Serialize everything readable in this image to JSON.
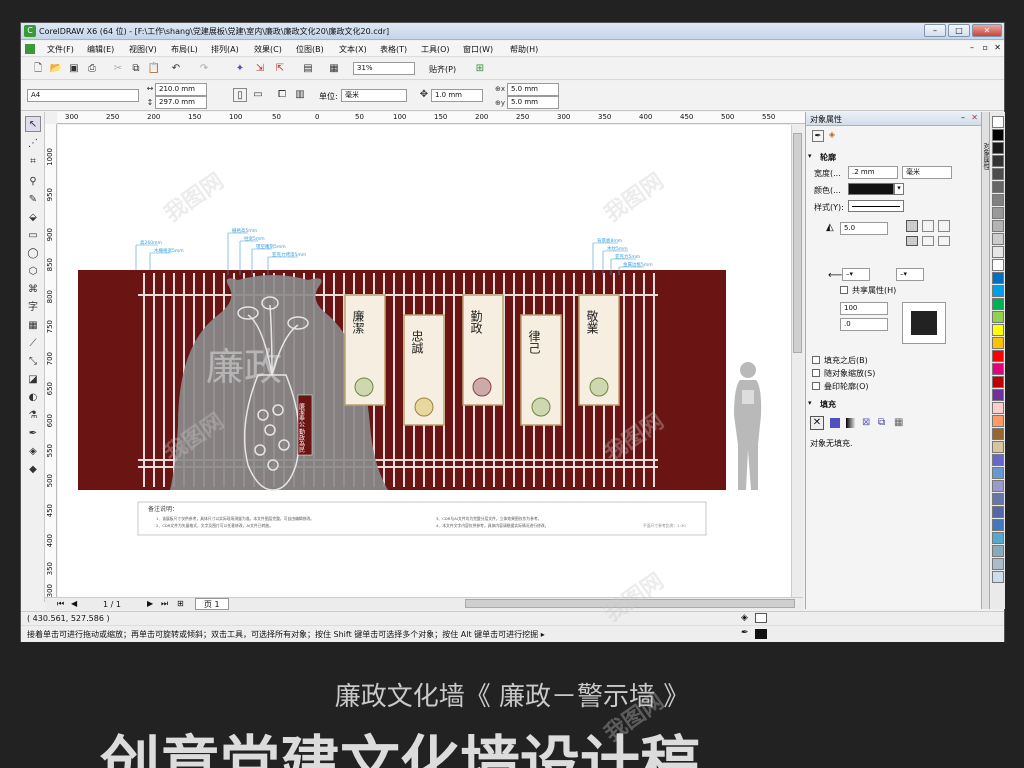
{
  "window_title": "CorelDRAW X6 (64 位) - [F:\\工作\\shang\\党建展板\\党建\\室内\\廉政\\廉政文化20\\廉政文化20.cdr]",
  "menu": [
    "文件(F)",
    "编辑(E)",
    "视图(V)",
    "布局(L)",
    "排列(A)",
    "效果(C)",
    "位图(B)",
    "文本(X)",
    "表格(T)",
    "工具(O)",
    "窗口(W)",
    "帮助(H)"
  ],
  "standard_bar": {
    "zoom": "31%",
    "snap": "贴齐(P)"
  },
  "property_bar": {
    "page_size": "A4",
    "width": "210.0 mm",
    "height": "297.0 mm",
    "units_label": "单位:",
    "units": "毫米",
    "nudge": "1.0 mm",
    "dup_x": "5.0 mm",
    "dup_y": "5.0 mm"
  },
  "hruler": [
    "300",
    "250",
    "200",
    "150",
    "100",
    "50",
    "0",
    "50",
    "100",
    "150",
    "200",
    "250",
    "300",
    "350",
    "400",
    "450",
    "500",
    "550"
  ],
  "vruler": [
    "1000",
    "950",
    "900",
    "850",
    "800",
    "750",
    "700",
    "650",
    "600",
    "550",
    "500",
    "450",
    "400",
    "350",
    "300"
  ],
  "design": {
    "wall_color": "#6b1414",
    "ghost_text": "廉政",
    "panels": [
      {
        "title": "廉潔"
      },
      {
        "title": "忠誠"
      },
      {
        "title": "勤政"
      },
      {
        "title": "律己"
      },
      {
        "title": "敬業"
      }
    ],
    "seal_text": "廉潔奉公 勤政為民",
    "notes_title": "备注说明：",
    "notes_left": [
      "1、该展板尺寸仅供参考，具体尺寸以实际现场测量为准。本文件图层完整，可自由编辑修改。",
      "2、CDR文件为矢量格式，文字及图片可以任意修改，AI文件已转曲。"
    ],
    "notes_right": [
      "3、CDR与AI文件均为完整分层文件，立体效果图仅作为参考。",
      "4、本文件文字内容仅供参考，具体内容请根据实际情况进行修改。"
    ],
    "notes_scale": "平面尺寸参考比例：1:30",
    "dim_left": [
      "高260mm",
      "木栅格宽5mm"
    ],
    "dim_mid": [
      "栅格高5mm",
      "柱宽5mm",
      "镂空雕刻5mm",
      "亚克力烤漆5mm"
    ],
    "dim_right": [
      "背景板8mm",
      "木纹5mm",
      "亚克力5mm",
      "金属边框5mm"
    ]
  },
  "page_nav": {
    "counter": "1 / 1",
    "tab": "页 1"
  },
  "status": {
    "coords": "( 430.561, 527.586 )",
    "hint": "接着单击可进行拖动或缩放；再单击可旋转或倾斜；双击工具，可选择所有对象；按住 Shift 键单击可选择多个对象；按住 Alt 键单击可进行挖掘 ▸"
  },
  "docker": {
    "title": "对象属性",
    "outline_section": "轮廓",
    "width_label": "宽度(...",
    "width_value": ".2 mm",
    "width_unit": "毫米",
    "color_label": "颜色(...",
    "style_label": "样式(Y):",
    "miter_value": "5.0",
    "share_attr": "共享属性(H)",
    "scale_value": "100",
    "angle_value": ".0",
    "fill_behind": "填充之后(B)",
    "scale_with": "随对象缩放(S)",
    "overprint": "叠印轮廓(O)",
    "fill_section": "填充",
    "fill_none": "对象无填充.",
    "side_tabs": "对象属性"
  },
  "palette_colors": [
    "#ffffff",
    "#000000",
    "#1a1a1a",
    "#333333",
    "#4d4d4d",
    "#666666",
    "#808080",
    "#999999",
    "#b3b3b3",
    "#cccccc",
    "#e6e6e6",
    "#ffffff",
    "#0070c0",
    "#00a0e9",
    "#00b050",
    "#92d050",
    "#ffff00",
    "#ffc000",
    "#ff0000",
    "#e4007f",
    "#c00000",
    "#7030a0",
    "#ffcccc",
    "#ff9966",
    "#996633",
    "#d9c3a0",
    "#6666cc",
    "#6699cc",
    "#9999cc",
    "#6677aa",
    "#5566aa",
    "#4477bb",
    "#55aacc",
    "#88aabb",
    "#aabbcc",
    "#ccddee"
  ],
  "caption": "廉政文化墙《 廉政－警示墙 》",
  "big_text": "创意党建文化墙设计稿",
  "watermark": "我图网"
}
